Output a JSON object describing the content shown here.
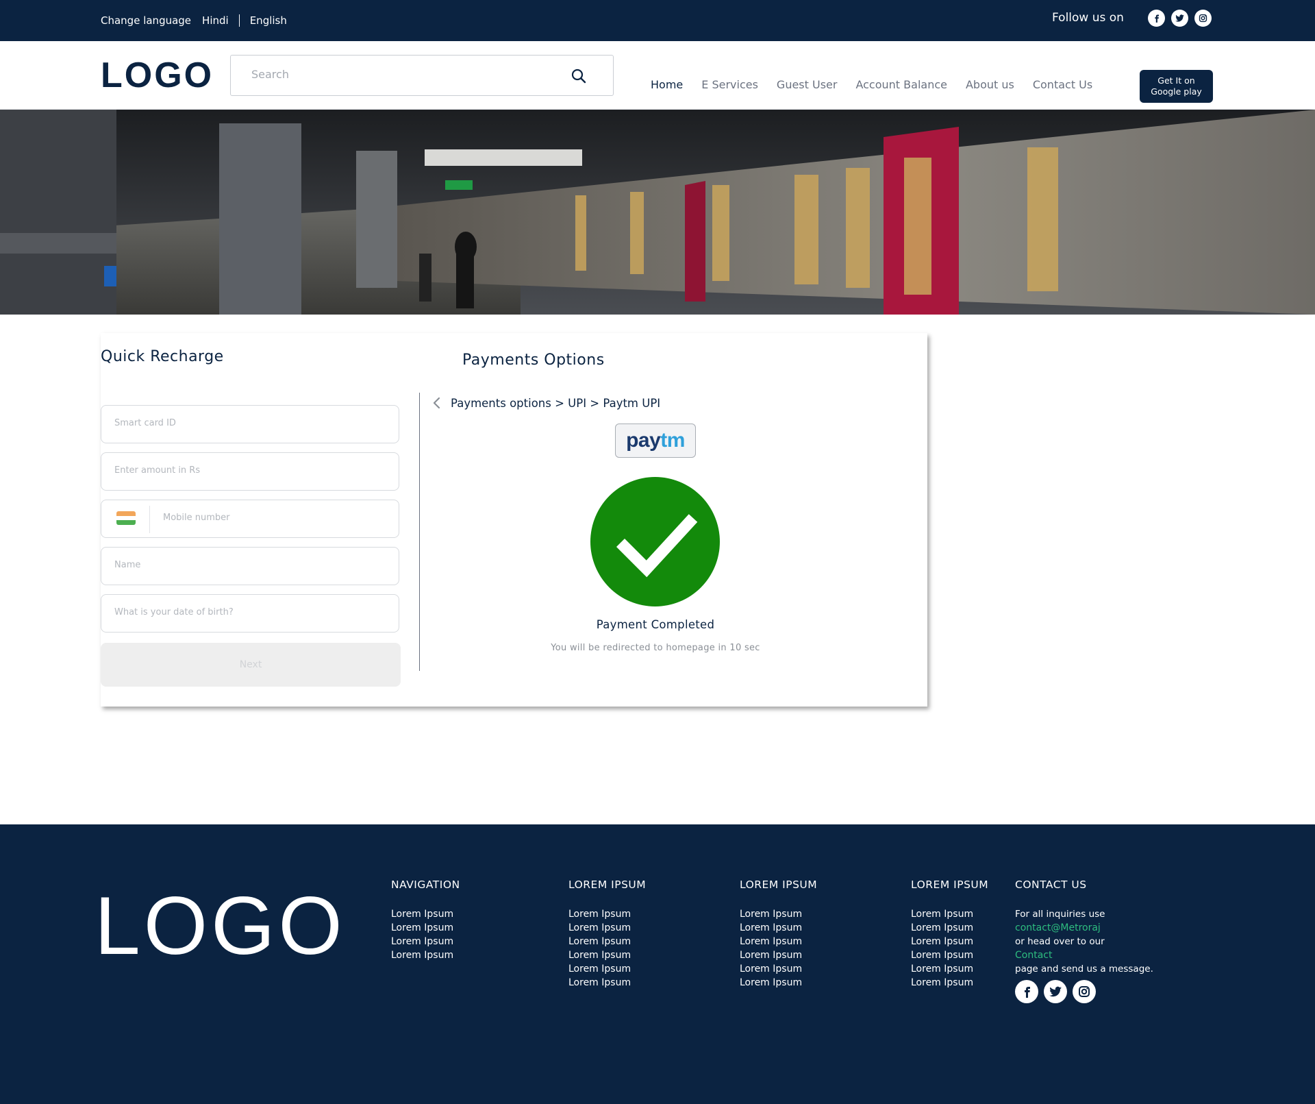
{
  "topbar": {
    "change_language": "Change language",
    "hindi": "Hindi",
    "english": "English",
    "follow_us": "Follow us on"
  },
  "header": {
    "logo": "LOGO",
    "search_placeholder": "Search",
    "nav": [
      "Home",
      "E Services",
      "Guest User",
      "Account Balance",
      "About us",
      "Contact Us"
    ],
    "gplay_line1": "Get It on",
    "gplay_line2": "Google play"
  },
  "quick_recharge": {
    "title": "Quick Recharge",
    "smart_card_placeholder": "Smart card ID",
    "amount_placeholder": "Enter amount in Rs",
    "mobile_placeholder": "Mobile number",
    "name_placeholder": "Name",
    "dob_placeholder": "What is your date of birth?",
    "next_label": "Next"
  },
  "payments": {
    "title": "Payments Options",
    "breadcrumb": "Payments options > UPI > Paytm UPI",
    "paytm_part1": "pay",
    "paytm_part2": "tm",
    "status": "Payment Completed",
    "redirect": "You will be redirected to homepage in 10 sec"
  },
  "footer": {
    "logo": "LOGO",
    "columns": [
      {
        "title": "NAVIGATION",
        "items": [
          "Lorem Ipsum",
          "Lorem Ipsum",
          "Lorem Ipsum",
          "Lorem Ipsum"
        ]
      },
      {
        "title": "LOREM IPSUM",
        "items": [
          "Lorem Ipsum",
          "Lorem Ipsum",
          "Lorem Ipsum",
          "Lorem Ipsum",
          "Lorem Ipsum",
          "Lorem Ipsum"
        ]
      },
      {
        "title": "LOREM IPSUM",
        "items": [
          "Lorem Ipsum",
          "Lorem Ipsum",
          "Lorem Ipsum",
          "Lorem Ipsum",
          "Lorem Ipsum",
          "Lorem Ipsum"
        ]
      },
      {
        "title": "LOREM IPSUM",
        "items": [
          "Lorem Ipsum",
          "Lorem Ipsum",
          "Lorem Ipsum",
          "Lorem Ipsum",
          "Lorem Ipsum",
          "Lorem Ipsum"
        ]
      }
    ],
    "contact": {
      "title": "CONTACT US",
      "text1": "For all inquiries use ",
      "email": "contact@Metroraj",
      "text2": " or head over to our ",
      "link": "Contact",
      "text3": " page and send us a message."
    }
  },
  "icons": {
    "social": [
      "facebook-icon",
      "twitter-icon",
      "instagram-icon"
    ],
    "search": "search-icon",
    "back": "chevron-left-icon",
    "success": "check-icon"
  },
  "colors": {
    "navy": "#0b2341",
    "success_green": "#138a0b",
    "link_green": "#2ebd7f",
    "paytm_dark": "#1b3a6d",
    "paytm_light": "#2fa0da"
  }
}
